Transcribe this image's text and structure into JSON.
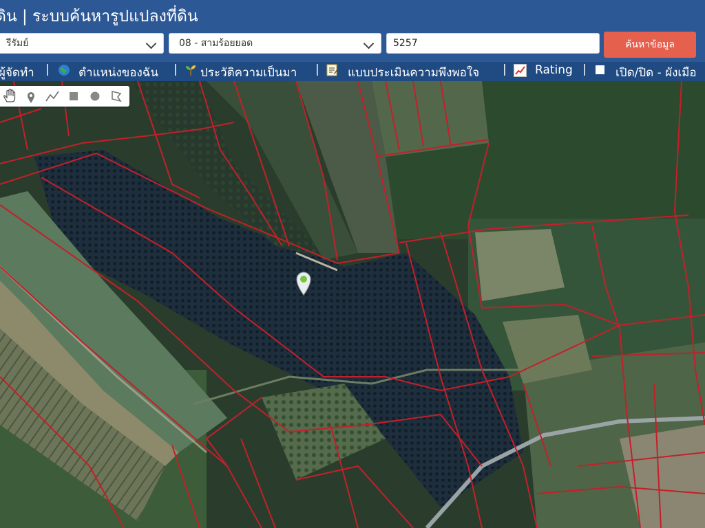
{
  "header": {
    "title": "ดิน | ระบบค้นหารูปแปลงที่ดิน"
  },
  "search": {
    "province_value": "รีรัมย์",
    "district_value": "08 - สามร้อยยอด",
    "parcel_number_value": "5257",
    "search_button_label": "ค้นหาข้อมูล"
  },
  "menu": {
    "items": [
      {
        "label": "ผู้จัดทำ",
        "icon": "partial"
      },
      {
        "label": "ตำแหน่งของฉัน",
        "icon": "globe-icon"
      },
      {
        "label": "ประวัติความเป็นมา",
        "icon": "sprout-icon"
      },
      {
        "label": "แบบประเมินความพึงพอใจ",
        "icon": "notepad-icon"
      },
      {
        "label": "Rating",
        "icon": "chart-icon"
      },
      {
        "label": "เปิด/ปิด - ผังเมือ",
        "icon": "checkbox-icon"
      }
    ],
    "separator": "|"
  },
  "map": {
    "tools": [
      "hand-icon",
      "marker-icon",
      "polyline-icon",
      "rectangle-icon",
      "circle-icon",
      "eraser-icon"
    ],
    "marker_color": "#7cc242",
    "parcel_line_color": "#c3202a"
  },
  "colors": {
    "header_bg": "#2d5896",
    "menu_bg": "#1f4a82",
    "button_bg": "#e5604d"
  }
}
